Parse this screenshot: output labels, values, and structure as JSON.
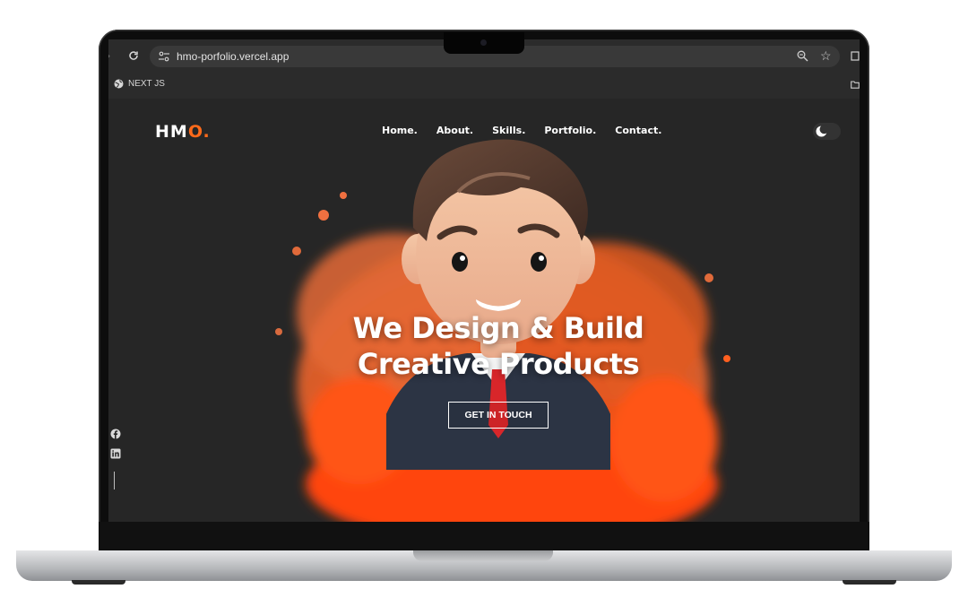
{
  "browser": {
    "url": "hmo-porfolio.vercel.app",
    "bookmarks": [
      {
        "label": "NEXT JS",
        "icon": "globe-icon"
      }
    ]
  },
  "site": {
    "logo": {
      "main": "HM",
      "accent": "O."
    },
    "nav": [
      "Home.",
      "About.",
      "Skills.",
      "Portfolio.",
      "Contact."
    ],
    "hero": {
      "line1": "We Design & Build",
      "line2": "Creative Products",
      "cta": "GET IN TOUCH"
    },
    "social": [
      "facebook-icon",
      "linkedin-icon"
    ],
    "theme_toggle_icon": "moon-icon"
  },
  "colors": {
    "accent": "#ff6a1a",
    "background": "#262626",
    "splash": "#ff4d12"
  }
}
